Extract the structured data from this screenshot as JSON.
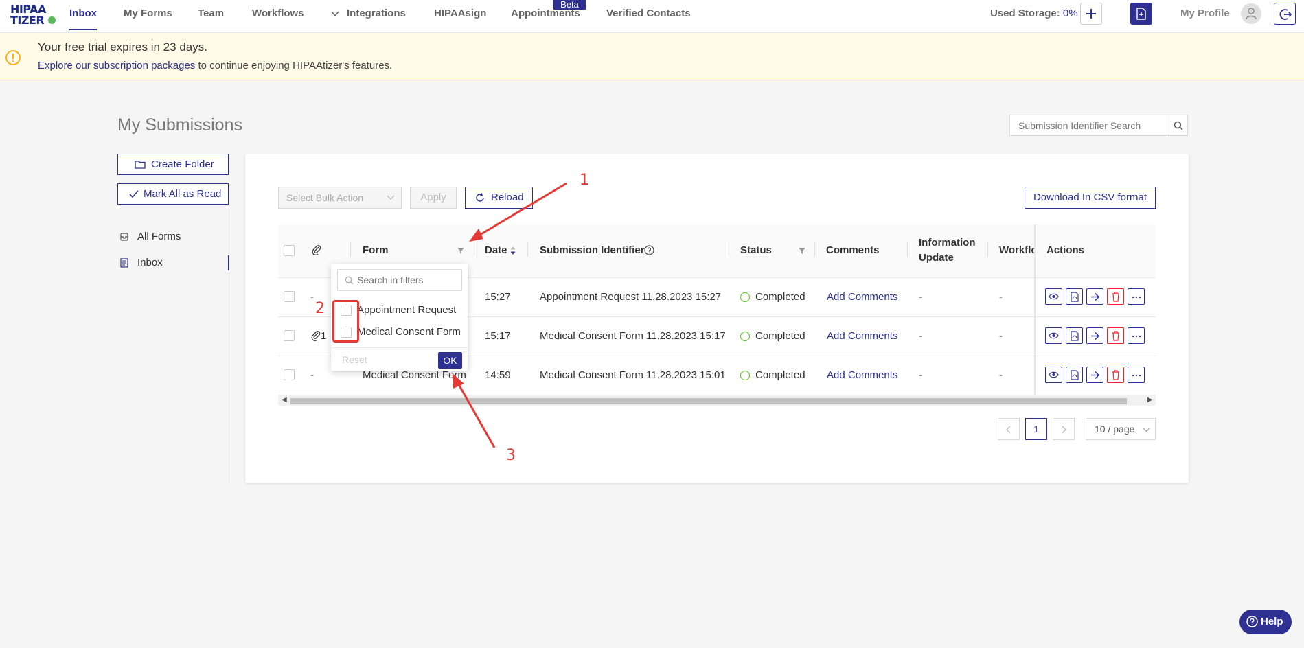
{
  "nav": {
    "logo_line1": "HIPAA",
    "logo_line2": "TIZER",
    "items": [
      "Inbox",
      "My Forms",
      "Team",
      "Workflows",
      "Integrations",
      "HIPAAsign",
      "Appointments",
      "Verified Contacts"
    ],
    "beta_badge": "Beta",
    "storage_label": "Used Storage:",
    "storage_value": "0%",
    "profile_label": "My Profile"
  },
  "banner": {
    "title": "Your free trial expires in 23 days.",
    "link_text": "Explore our subscription packages",
    "rest_text": " to continue enjoying HIPAAtizer's features."
  },
  "page": {
    "title": "My Submissions",
    "search_placeholder": "Submission Identifier Search"
  },
  "sidebar": {
    "create_folder": "Create Folder",
    "mark_all_read": "Mark All as Read",
    "items": [
      "All Forms",
      "Inbox"
    ]
  },
  "toolbar": {
    "bulk_placeholder": "Select Bulk Action",
    "apply": "Apply",
    "reload": "Reload",
    "csv": "Download In CSV format"
  },
  "table": {
    "headers": {
      "form": "Form",
      "date": "Date",
      "identifier": "Submission Identifier",
      "status": "Status",
      "comments": "Comments",
      "info_update_1": "Information",
      "info_update_2": "Update",
      "workflow": "Workflo",
      "actions": "Actions"
    },
    "rows": [
      {
        "attach": "-",
        "form": "",
        "date": "15:27",
        "identifier": "Appointment Request 11.28.2023 15:27",
        "status": "Completed",
        "comments": "Add Comments",
        "info_update": "-",
        "workflow": "-"
      },
      {
        "attach": "1",
        "form": "",
        "date": "15:17",
        "identifier": "Medical Consent Form 11.28.2023 15:17",
        "status": "Completed",
        "comments": "Add Comments",
        "info_update": "-",
        "workflow": "-"
      },
      {
        "attach": "-",
        "form": "Medical Consent Form",
        "date": "14:59",
        "identifier": "Medical Consent Form 11.28.2023 15:01",
        "status": "Completed",
        "comments": "Add Comments",
        "info_update": "-",
        "workflow": "-"
      }
    ]
  },
  "pagination": {
    "current": "1",
    "page_size": "10 / page"
  },
  "filter_dropdown": {
    "search_placeholder": "Search in filters",
    "options": [
      "Appointment Request",
      "Medical Consent Form"
    ],
    "reset": "Reset",
    "ok": "OK"
  },
  "annotations": [
    "1",
    "2",
    "3"
  ],
  "help": "Help",
  "colors": {
    "brand": "#2e3192",
    "annotation": "#e53935",
    "success": "#52c41a",
    "danger": "#f5222d",
    "banner_bg": "#fffbe6"
  }
}
